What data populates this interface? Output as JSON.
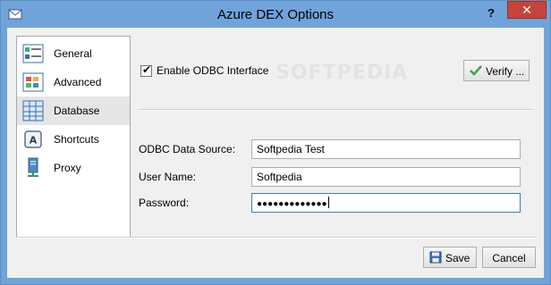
{
  "window": {
    "title": "Azure DEX Options",
    "help_label": "?",
    "close_label": "✕"
  },
  "sidebar": {
    "selected": "Database",
    "items": [
      {
        "label": "General",
        "icon": "general-icon"
      },
      {
        "label": "Advanced",
        "icon": "advanced-icon"
      },
      {
        "label": "Database",
        "icon": "database-icon"
      },
      {
        "label": "Shortcuts",
        "icon": "shortcuts-icon"
      },
      {
        "label": "Proxy",
        "icon": "proxy-icon"
      }
    ]
  },
  "database": {
    "enable_odbc": {
      "label": "Enable ODBC Interface",
      "checked": true,
      "check_glyph": "✔"
    },
    "verify_label": "Verify ...",
    "watermark": "SOFTPEDIA",
    "fields": [
      {
        "label": "ODBC Data Source:",
        "value": "Softpedia Test"
      },
      {
        "label": "User Name:",
        "value": "Softpedia"
      },
      {
        "label": "Password:",
        "value": "●●●●●●●●●●●●●"
      }
    ]
  },
  "footer": {
    "save_label": "Save",
    "cancel_label": "Cancel"
  },
  "colors": {
    "titlebar": "#6fa3da",
    "close_button": "#c7443c",
    "selected_item": "#e5e5e5",
    "focus_border": "#3c7fb1"
  }
}
